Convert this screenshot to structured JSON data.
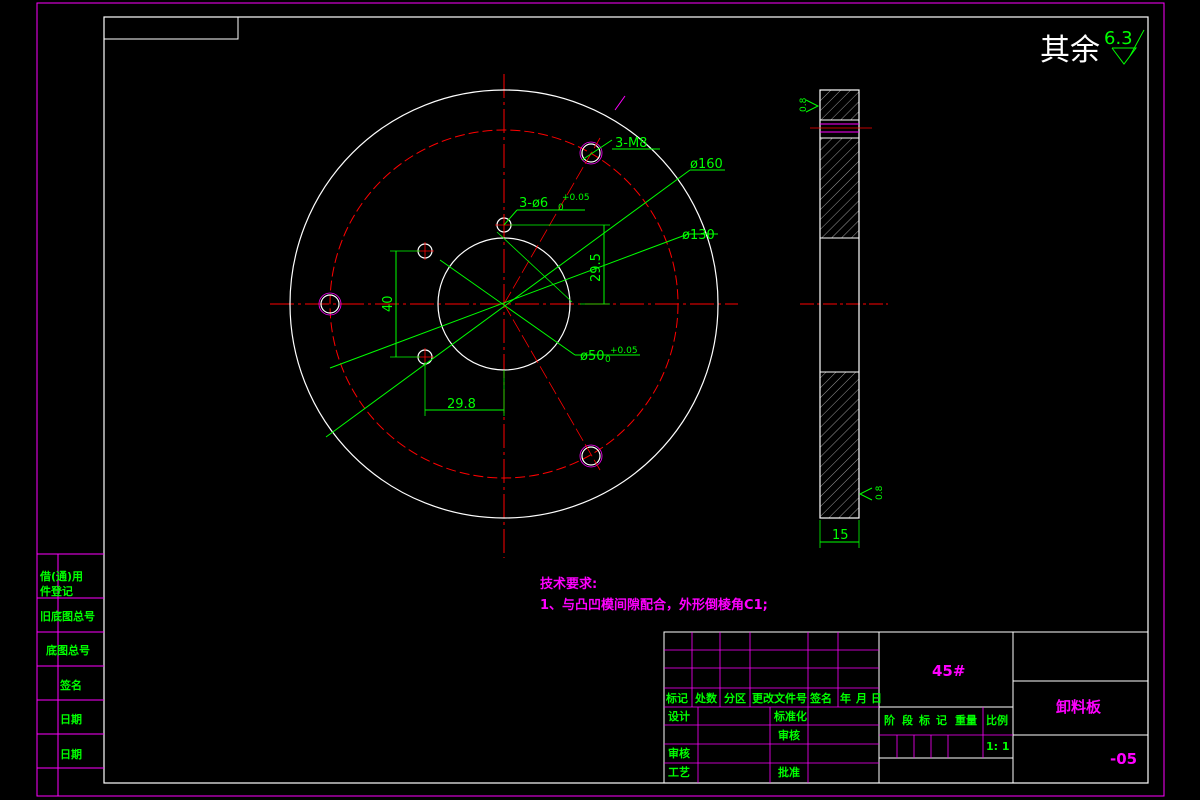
{
  "roughness": {
    "prefix": "其余",
    "value": "6.3"
  },
  "dimensions": {
    "threaded_holes": "3-M8",
    "outer_dia": "ø160",
    "bolt_circle": "ø130",
    "pin_holes": "3-ø6",
    "pin_tol_upper": "+0.05",
    "pin_tol_lower": "0",
    "center_bore": "ø50",
    "bore_tol_upper": "+0.05",
    "bore_tol_lower": "0",
    "vertical_offset": "29.5",
    "pin_spacing": "40",
    "horizontal_offset": "29.8",
    "thickness": "15",
    "side_roughness_top": "0.8",
    "side_roughness_bottom": "0.8"
  },
  "tech_requirements": {
    "title": "技术要求:",
    "item1": "1、与凸凹模间隙配合，外形倒棱角C1;"
  },
  "side_panel": [
    "借(通)用",
    "件登记",
    "旧底图总号",
    "底图总号",
    "签名",
    "日期",
    "日期"
  ],
  "title_block": {
    "material": "45#",
    "part_name": "卸料板",
    "drawing_no": "-05",
    "header_row": [
      "标记",
      "处数",
      "分区",
      "更改文件号",
      "签名",
      "年",
      "月",
      "日"
    ],
    "design": "设计",
    "standardization": "标准化",
    "checking": "审核",
    "process": "工艺",
    "review": "审核",
    "approve": "批准",
    "stage_header": [
      "阶",
      "段",
      "标",
      "记",
      "重量",
      "比例"
    ],
    "scale": "1: 1"
  },
  "colors": {
    "frame": "#ff00ff",
    "geometry": "#ffffff",
    "centerline": "#ff0000",
    "dimension": "#00ff00",
    "text_note": "#ff00ff"
  }
}
